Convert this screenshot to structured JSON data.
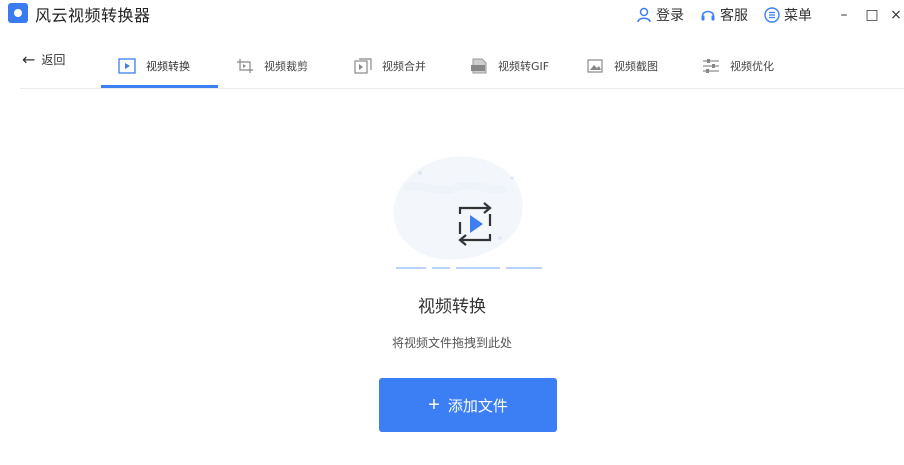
{
  "app": {
    "title": "风云视频转换器",
    "accent_color": "#3c7ef3"
  },
  "titlebar": {
    "login_label": "登录",
    "service_label": "客服",
    "menu_label": "菜单",
    "minimize_glyph": "–",
    "maximize_glyph": "□",
    "close_glyph": "×"
  },
  "nav": {
    "back_label": "返回",
    "tabs": [
      {
        "label": "视频转换",
        "icon": "play-square-icon",
        "active": true
      },
      {
        "label": "视频裁剪",
        "icon": "crop-icon",
        "active": false
      },
      {
        "label": "视频合并",
        "icon": "merge-icon",
        "active": false
      },
      {
        "label": "视频转GIF",
        "icon": "gif-icon",
        "active": false
      },
      {
        "label": "视频截图",
        "icon": "screenshot-icon",
        "active": false
      },
      {
        "label": "视频优化",
        "icon": "sliders-icon",
        "active": false
      }
    ]
  },
  "main": {
    "title": "视频转换",
    "subtitle": "将视频文件拖拽到此处",
    "add_button_label": "添加文件",
    "add_button_icon": "plus-icon"
  }
}
